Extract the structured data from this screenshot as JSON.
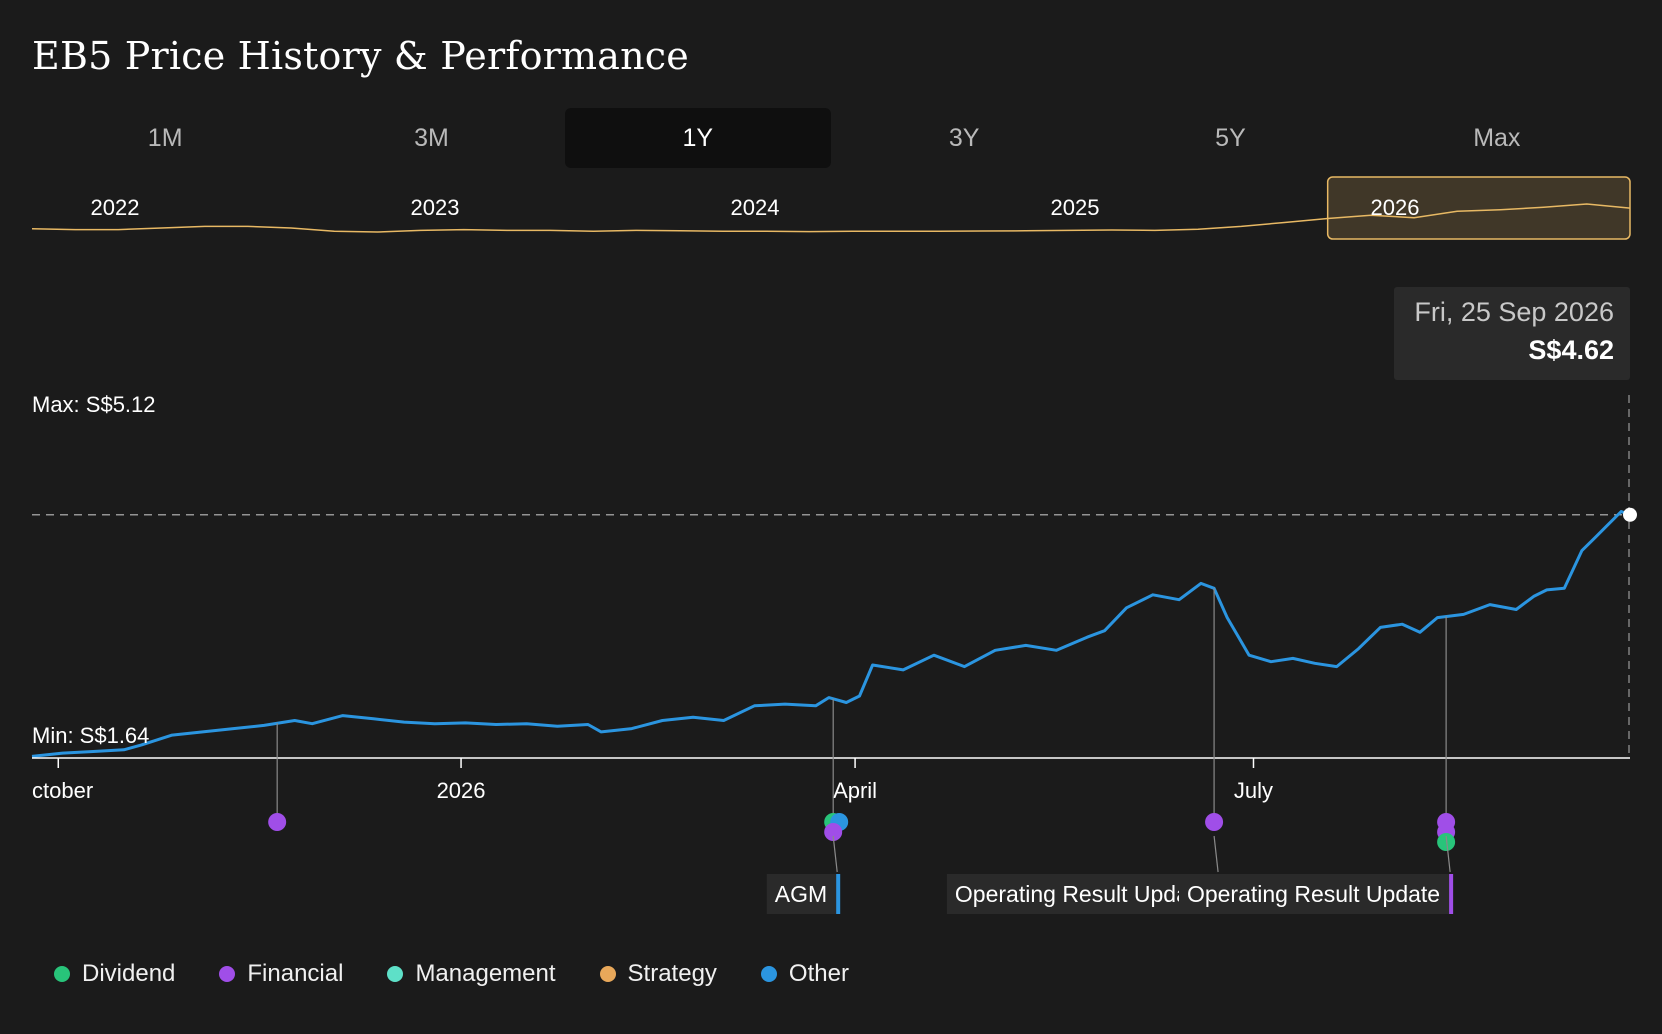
{
  "title": "EB5 Price History & Performance",
  "tabs": [
    {
      "label": "1M",
      "active": false
    },
    {
      "label": "3M",
      "active": false
    },
    {
      "label": "1Y",
      "active": true
    },
    {
      "label": "3Y",
      "active": false
    },
    {
      "label": "5Y",
      "active": false
    },
    {
      "label": "Max",
      "active": false
    }
  ],
  "tooltip": {
    "date": "Fri, 25 Sep 2026",
    "price": "S$4.62"
  },
  "colors": {
    "background": "#1b1b1b",
    "price_line": "#2b95e0",
    "navigator_line": "#e8b964",
    "dividend": "#28c47a",
    "financial": "#a04ee8",
    "management": "#5ee0c8",
    "strategy": "#e8a85a",
    "other": "#2b95e0"
  },
  "legend": [
    {
      "label": "Dividend",
      "color": "#28c47a"
    },
    {
      "label": "Financial",
      "color": "#a04ee8"
    },
    {
      "label": "Management",
      "color": "#5ee0c8"
    },
    {
      "label": "Strategy",
      "color": "#e8a85a"
    },
    {
      "label": "Other",
      "color": "#2b95e0"
    }
  ],
  "chart_data": {
    "type": "line",
    "currency": "S$",
    "max_label": "Max: S$5.12",
    "min_label": "Min: S$1.64",
    "y_range": [
      1.64,
      5.12
    ],
    "current_value": 4.62,
    "x_range": [
      "2025-09-25",
      "2026-09-25"
    ],
    "x_ticks": [
      {
        "date": "2025-10-01",
        "label": "ctober"
      },
      {
        "date": "2026-01-01",
        "label": "2026"
      },
      {
        "date": "2026-04-01",
        "label": "April"
      },
      {
        "date": "2026-07-01",
        "label": "July"
      }
    ],
    "series": [
      {
        "points": [
          [
            "2025-09-25",
            1.66
          ],
          [
            "2025-10-02",
            1.7
          ],
          [
            "2025-10-09",
            1.72
          ],
          [
            "2025-10-16",
            1.74
          ],
          [
            "2025-10-20",
            1.8
          ],
          [
            "2025-10-27",
            1.92
          ],
          [
            "2025-11-03",
            1.96
          ],
          [
            "2025-11-10",
            2.0
          ],
          [
            "2025-11-17",
            2.04
          ],
          [
            "2025-11-24",
            2.1
          ],
          [
            "2025-11-28",
            2.06
          ],
          [
            "2025-12-05",
            2.16
          ],
          [
            "2025-12-12",
            2.12
          ],
          [
            "2025-12-19",
            2.08
          ],
          [
            "2025-12-26",
            2.06
          ],
          [
            "2026-01-02",
            2.07
          ],
          [
            "2026-01-09",
            2.05
          ],
          [
            "2026-01-16",
            2.06
          ],
          [
            "2026-01-23",
            2.03
          ],
          [
            "2026-01-30",
            2.05
          ],
          [
            "2026-02-02",
            1.96
          ],
          [
            "2026-02-09",
            2.0
          ],
          [
            "2026-02-16",
            2.1
          ],
          [
            "2026-02-23",
            2.14
          ],
          [
            "2026-03-02",
            2.1
          ],
          [
            "2026-03-09",
            2.28
          ],
          [
            "2026-03-16",
            2.3
          ],
          [
            "2026-03-23",
            2.28
          ],
          [
            "2026-03-26",
            2.38
          ],
          [
            "2026-03-30",
            2.32
          ],
          [
            "2026-04-02",
            2.4
          ],
          [
            "2026-04-05",
            2.78
          ],
          [
            "2026-04-12",
            2.72
          ],
          [
            "2026-04-19",
            2.9
          ],
          [
            "2026-04-26",
            2.76
          ],
          [
            "2026-05-03",
            2.96
          ],
          [
            "2026-05-10",
            3.02
          ],
          [
            "2026-05-17",
            2.96
          ],
          [
            "2026-05-24",
            3.12
          ],
          [
            "2026-05-28",
            3.2
          ],
          [
            "2026-06-02",
            3.48
          ],
          [
            "2026-06-08",
            3.64
          ],
          [
            "2026-06-14",
            3.58
          ],
          [
            "2026-06-19",
            3.78
          ],
          [
            "2026-06-22",
            3.72
          ],
          [
            "2026-06-25",
            3.36
          ],
          [
            "2026-06-30",
            2.9
          ],
          [
            "2026-07-05",
            2.82
          ],
          [
            "2026-07-10",
            2.86
          ],
          [
            "2026-07-15",
            2.8
          ],
          [
            "2026-07-20",
            2.76
          ],
          [
            "2026-07-25",
            2.98
          ],
          [
            "2026-07-30",
            3.24
          ],
          [
            "2026-08-04",
            3.28
          ],
          [
            "2026-08-08",
            3.18
          ],
          [
            "2026-08-12",
            3.36
          ],
          [
            "2026-08-18",
            3.4
          ],
          [
            "2026-08-24",
            3.52
          ],
          [
            "2026-08-30",
            3.46
          ],
          [
            "2026-09-03",
            3.62
          ],
          [
            "2026-09-06",
            3.7
          ],
          [
            "2026-09-10",
            3.72
          ],
          [
            "2026-09-14",
            4.18
          ],
          [
            "2026-09-17",
            4.34
          ],
          [
            "2026-09-20",
            4.5
          ],
          [
            "2026-09-23",
            4.66
          ],
          [
            "2026-09-25",
            4.62
          ]
        ]
      }
    ],
    "events": [
      {
        "date": "2025-11-20",
        "types": [
          "financial"
        ],
        "label": ""
      },
      {
        "date": "2026-03-27",
        "types": [
          "dividend",
          "other",
          "financial"
        ],
        "label": "AGM"
      },
      {
        "date": "2026-06-22",
        "types": [
          "financial"
        ],
        "label": "Operating Result Update"
      },
      {
        "date": "2026-08-14",
        "types": [
          "financial",
          "financial",
          "dividend"
        ],
        "label": "Operating Result Update"
      }
    ],
    "navigator": {
      "year_labels": [
        "2022",
        "2023",
        "2024",
        "2025",
        "2026"
      ],
      "selected": "1Y",
      "values": [
        2.0,
        1.9,
        1.9,
        2.1,
        2.3,
        2.3,
        2.1,
        1.7,
        1.6,
        1.8,
        1.9,
        1.8,
        1.8,
        1.7,
        1.8,
        1.75,
        1.7,
        1.7,
        1.65,
        1.7,
        1.7,
        1.7,
        1.72,
        1.75,
        1.8,
        1.85,
        1.8,
        1.95,
        2.3,
        2.8,
        3.3,
        3.7,
        3.4,
        4.2,
        4.4,
        4.7,
        5.12,
        4.6
      ]
    }
  }
}
